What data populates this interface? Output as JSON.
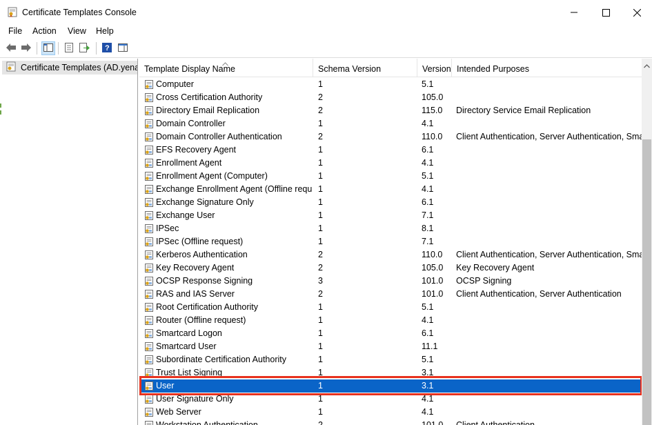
{
  "window": {
    "title": "Certificate Templates Console",
    "accent_selected": "#0a64c8",
    "highlight_color": "#e8321e"
  },
  "menu": [
    "File",
    "Action",
    "View",
    "Help"
  ],
  "toolbar": {
    "buttons": [
      "back-arrow-icon",
      "forward-arrow-icon",
      "show-hide-tree-icon",
      "properties-icon",
      "export-list-icon",
      "help-icon",
      "action-pane-icon"
    ]
  },
  "tree": {
    "root_label": "Certificate Templates (AD.yenalt"
  },
  "columns": [
    "Template Display Name",
    "Schema Version",
    "Version",
    "Intended Purposes"
  ],
  "rows": [
    {
      "name": "Computer",
      "schema": "1",
      "version": "5.1",
      "purposes": ""
    },
    {
      "name": "Cross Certification Authority",
      "schema": "2",
      "version": "105.0",
      "purposes": ""
    },
    {
      "name": "Directory Email Replication",
      "schema": "2",
      "version": "115.0",
      "purposes": "Directory Service Email Replication"
    },
    {
      "name": "Domain Controller",
      "schema": "1",
      "version": "4.1",
      "purposes": ""
    },
    {
      "name": "Domain Controller Authentication",
      "schema": "2",
      "version": "110.0",
      "purposes": "Client Authentication, Server Authentication, Smart"
    },
    {
      "name": "EFS Recovery Agent",
      "schema": "1",
      "version": "6.1",
      "purposes": ""
    },
    {
      "name": "Enrollment Agent",
      "schema": "1",
      "version": "4.1",
      "purposes": ""
    },
    {
      "name": "Enrollment Agent (Computer)",
      "schema": "1",
      "version": "5.1",
      "purposes": ""
    },
    {
      "name": "Exchange Enrollment Agent (Offline requ...",
      "schema": "1",
      "version": "4.1",
      "purposes": ""
    },
    {
      "name": "Exchange Signature Only",
      "schema": "1",
      "version": "6.1",
      "purposes": ""
    },
    {
      "name": "Exchange User",
      "schema": "1",
      "version": "7.1",
      "purposes": ""
    },
    {
      "name": "IPSec",
      "schema": "1",
      "version": "8.1",
      "purposes": ""
    },
    {
      "name": "IPSec (Offline request)",
      "schema": "1",
      "version": "7.1",
      "purposes": ""
    },
    {
      "name": "Kerberos Authentication",
      "schema": "2",
      "version": "110.0",
      "purposes": "Client Authentication, Server Authentication, Smart"
    },
    {
      "name": "Key Recovery Agent",
      "schema": "2",
      "version": "105.0",
      "purposes": "Key Recovery Agent"
    },
    {
      "name": "OCSP Response Signing",
      "schema": "3",
      "version": "101.0",
      "purposes": "OCSP Signing"
    },
    {
      "name": "RAS and IAS Server",
      "schema": "2",
      "version": "101.0",
      "purposes": "Client Authentication, Server Authentication"
    },
    {
      "name": "Root Certification Authority",
      "schema": "1",
      "version": "5.1",
      "purposes": ""
    },
    {
      "name": "Router (Offline request)",
      "schema": "1",
      "version": "4.1",
      "purposes": ""
    },
    {
      "name": "Smartcard Logon",
      "schema": "1",
      "version": "6.1",
      "purposes": ""
    },
    {
      "name": "Smartcard User",
      "schema": "1",
      "version": "11.1",
      "purposes": ""
    },
    {
      "name": "Subordinate Certification Authority",
      "schema": "1",
      "version": "5.1",
      "purposes": ""
    },
    {
      "name": "Trust List Signing",
      "schema": "1",
      "version": "3.1",
      "purposes": ""
    },
    {
      "name": "User",
      "schema": "1",
      "version": "3.1",
      "purposes": "",
      "selected": true
    },
    {
      "name": "User Signature Only",
      "schema": "1",
      "version": "4.1",
      "purposes": ""
    },
    {
      "name": "Web Server",
      "schema": "1",
      "version": "4.1",
      "purposes": ""
    },
    {
      "name": "Workstation Authentication",
      "schema": "2",
      "version": "101.0",
      "purposes": "Client Authentication"
    }
  ]
}
